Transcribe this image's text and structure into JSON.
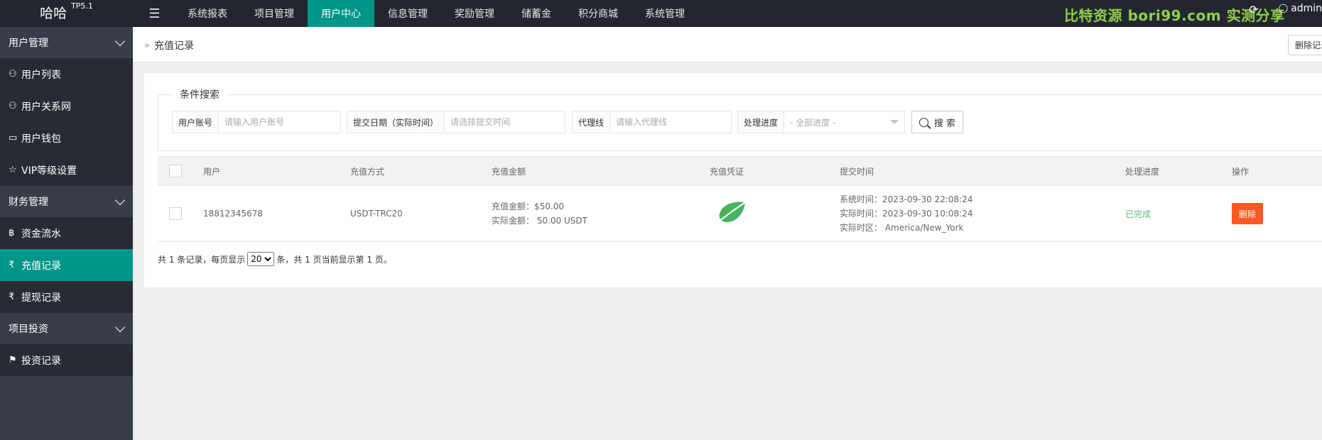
{
  "app": {
    "name": "哈哈",
    "version": "TP5.1"
  },
  "nav": {
    "toggle_icon": "menu-icon",
    "items": [
      {
        "label": "系统报表"
      },
      {
        "label": "项目管理"
      },
      {
        "label": "用户中心",
        "active": true
      },
      {
        "label": "信息管理"
      },
      {
        "label": "奖励管理"
      },
      {
        "label": "储蓄金"
      },
      {
        "label": "积分商城"
      },
      {
        "label": "系统管理"
      }
    ],
    "accent": "#009688"
  },
  "watermark": "比特资源 bori99.com 实测分享",
  "user": {
    "name": "admin"
  },
  "sidebar": {
    "groups": [
      {
        "label": "用户管理",
        "items": [
          {
            "label": "用户列表",
            "icon": "user-icon"
          },
          {
            "label": "用户关系网",
            "icon": "users-icon"
          },
          {
            "label": "用户钱包",
            "icon": "wallet-icon"
          },
          {
            "label": "VIP等级设置",
            "icon": "star-icon"
          }
        ]
      },
      {
        "label": "财务管理",
        "items": [
          {
            "label": "资金流水",
            "icon": "bitcoin-icon"
          },
          {
            "label": "充值记录",
            "icon": "rupee-icon",
            "active": true
          },
          {
            "label": "提现记录",
            "icon": "rupee-icon"
          }
        ]
      },
      {
        "label": "项目投资",
        "items": [
          {
            "label": "投资记录",
            "icon": "flag-icon"
          }
        ]
      }
    ]
  },
  "breadcrumb": {
    "current": "充值记录"
  },
  "toolbar": {
    "delete_label": "删除记录"
  },
  "search": {
    "legend": "条件搜索",
    "fields": [
      {
        "label": "用户账号",
        "placeholder": "请输入用户账号"
      },
      {
        "label": "提交日期（实际时间）",
        "placeholder": "请选择提交时间"
      },
      {
        "label": "代理线",
        "placeholder": "请输入代理线"
      },
      {
        "label": "处理进度",
        "selected": "- 全部进度 -"
      }
    ],
    "button_label": "搜 索"
  },
  "table": {
    "headers": [
      "用户",
      "充值方式",
      "充值金额",
      "充值凭证",
      "提交时间",
      "处理进度",
      "操作"
    ],
    "rows": [
      {
        "user": "18812345678",
        "method": "USDT-TRC20",
        "amount_line1": "充值金额：$50.00",
        "amount_line2": "实际金额：  50.00 USDT",
        "voucher_icon": "leaf-icon",
        "time_line1": "系统时间：2023-09-30 22:08:24",
        "time_line2": "实际时间：2023-09-30 10:08:24",
        "time_line3": "实际时区：  America/New_York",
        "status": "已完成",
        "action": "删除"
      }
    ]
  },
  "pager": {
    "prefix": "共 1 条记录，每页显示",
    "per_page": "20",
    "suffix": "条，共 1 页当前显示第 1 页。"
  },
  "colors": {
    "danger": "#ff5722",
    "success": "#5fb878",
    "sidebar": "#393d49",
    "topbar": "#23262e"
  }
}
